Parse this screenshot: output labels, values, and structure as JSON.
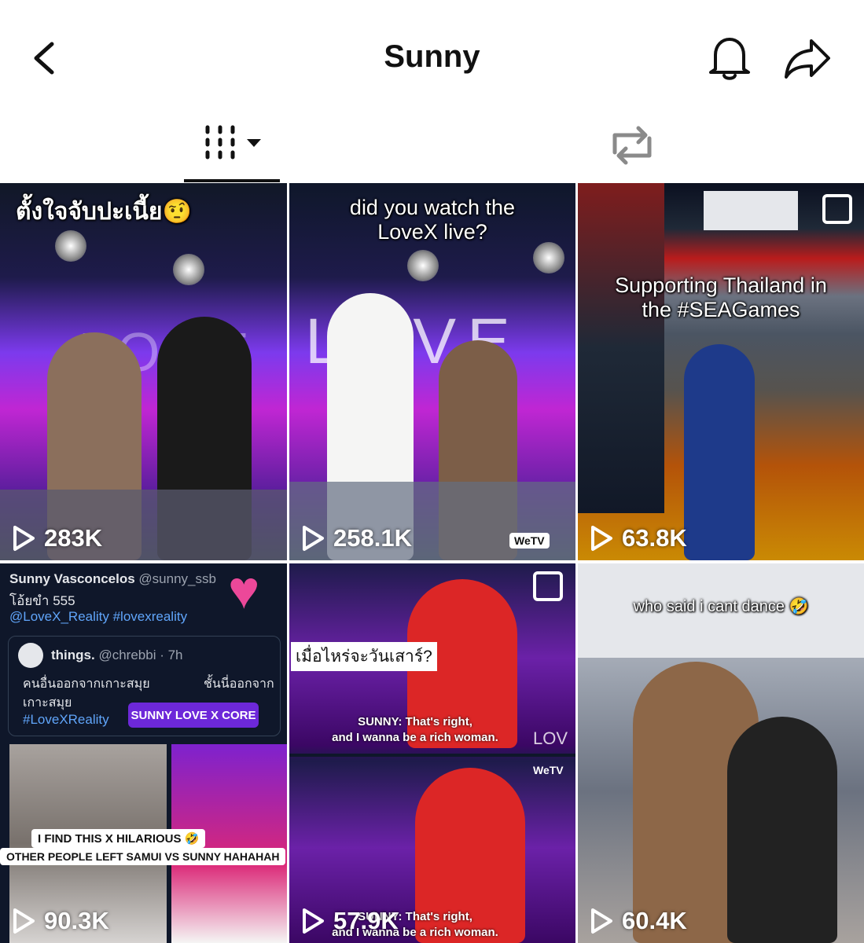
{
  "header": {
    "title": "Sunny",
    "back_icon": "chevron-left-icon",
    "notification_icon": "bell-icon",
    "share_icon": "share-arrow-icon"
  },
  "tabs": {
    "videos_icon": "grid-columns-icon",
    "dropdown_icon": "caret-down-icon",
    "reposts_icon": "repost-icon"
  },
  "videos": [
    {
      "caption": "ตั้งใจจับปะเนี้ย🤨",
      "views": "283K",
      "bg_watermark": "LOVE"
    },
    {
      "caption": "did you watch the LoveX live?",
      "views": "258.1K",
      "bg_watermark": "LOVE",
      "badge": "WeTV"
    },
    {
      "caption": "Supporting Thailand in the #SEAGames",
      "views": "63.8K"
    },
    {
      "views": "90.3K",
      "tweet": {
        "author": "Sunny Vasconcelos",
        "handle": "@sunny_ssb",
        "text": "โอ้ยขำ 555",
        "tags": "@LoveX_Reality #lovexreality",
        "quoted_author": "things.",
        "quoted_handle": "@chrebbi · 7h",
        "quoted_text_left": "คนอื่นออกจากเกาะสมุย",
        "quoted_text_right": "ชั้นนี่ออกจาก",
        "quoted_text_line2": "เกาะสมุย",
        "quoted_tag": "#LoveXReality",
        "banner": "SUNNY LOVE X CORE"
      },
      "meme_line1": "I FIND THIS X HILARIOUS 🤣",
      "meme_line2": "OTHER PEOPLE LEFT SAMUI VS SUNNY HAHAHAH"
    },
    {
      "views": "57.9K",
      "caption": "เมื่อไหร่จะวันเสาร์?",
      "subtitle1": "SUNNY: That's right,",
      "subtitle2": "and I wanna be a rich woman.",
      "subtitle3": "SUNNY: That's right,",
      "subtitle4": "and I wanna be a rich woman.",
      "badge": "WeTV",
      "watermark": "LOV"
    },
    {
      "caption": "who said i cant dance 🤣",
      "views": "60.4K"
    }
  ],
  "colors": {
    "accent": "#111111",
    "icon_gray": "#8a8a8a"
  }
}
